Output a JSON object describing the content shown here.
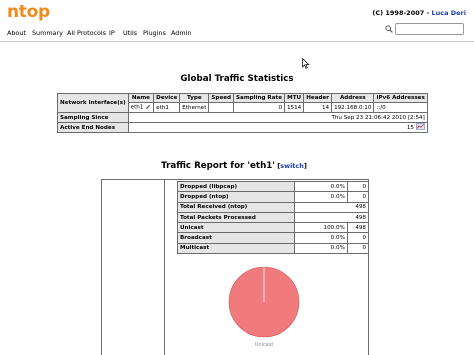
{
  "header": {
    "logo": "ntop",
    "copyright_prefix": "(C) 1998-2007 - ",
    "copyright_author": "Luca Deri"
  },
  "menu": {
    "items": [
      "About",
      "Summary",
      "All Protocols",
      "IP",
      "Utils",
      "Plugins",
      "Admin"
    ]
  },
  "search": {
    "value": "",
    "placeholder": ""
  },
  "global": {
    "title": "Global Traffic Statistics",
    "interfaces_label": "Network Interface(s)",
    "columns": [
      "Name",
      "Device",
      "Type",
      "Speed",
      "Sampling Rate",
      "MTU",
      "Header",
      "Address",
      "IPv6 Addresses"
    ],
    "row": {
      "name": "eth1",
      "device": "eth1",
      "type": "Ethernet",
      "speed": "",
      "sampling_rate": "0",
      "mtu": "1514",
      "header": "14",
      "address": "192.168.0.10",
      "ipv6": "::/0"
    },
    "sampling_since_label": "Sampling Since",
    "sampling_since_value": "Thu Sep 23 21:06:42 2010 [2:54]",
    "active_end_nodes_label": "Active End Nodes",
    "active_end_nodes_value": "15"
  },
  "report": {
    "title": "Traffic Report for 'eth1'",
    "switch_open": " [",
    "switch_label": "switch",
    "switch_close": "]",
    "rows": [
      {
        "label": "Dropped (libpcap)",
        "pct": "0.0%",
        "value": "0"
      },
      {
        "label": "Dropped (ntop)",
        "pct": "0.0%",
        "value": "0"
      },
      {
        "label": "Total Received (ntop)",
        "pct": "",
        "value": "498"
      },
      {
        "label": "Total Packets Processed",
        "pct": "",
        "value": "498"
      },
      {
        "label": "Unicast",
        "pct": "100.0%",
        "value": "498"
      },
      {
        "label": "Broadcast",
        "pct": "0.0%",
        "value": "0"
      },
      {
        "label": "Multicast",
        "pct": "0.0%",
        "value": "0"
      }
    ],
    "pie_legend": "Unicast",
    "pie_color": "#f07a7c"
  },
  "colors": {
    "logo": "#f08a1c",
    "link": "#1a3fb0",
    "header_cell": "#e6e6e6"
  }
}
